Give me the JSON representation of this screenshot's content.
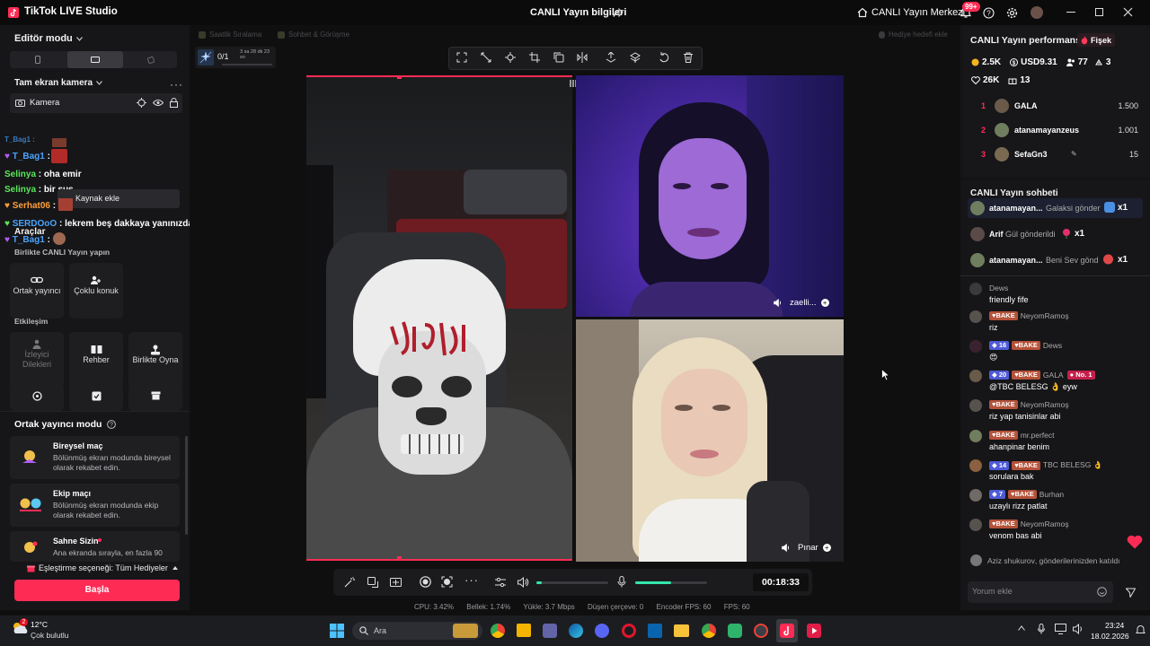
{
  "app": {
    "title": "TikTok LIVE Studio",
    "center_title": "CANLI Yayın bilgileri",
    "live_center": "CANLI Yayın Merkezi",
    "notif_badge": "99+"
  },
  "left": {
    "editor_mode": "Editör modu",
    "camera_mode": "Tam ekran kamera",
    "camera_source": "Kamera",
    "overlay_chat": [
      {
        "user": "T_Bag1",
        "msg": "",
        "user_color": "#4aa3ff"
      },
      {
        "user": "Selinya",
        "msg": "oha emir",
        "user_color": "#5ce65c"
      },
      {
        "user": "Selinya",
        "msg": "bir sus",
        "user_color": "#5ce65c"
      },
      {
        "user": "Serhat06",
        "msg": "",
        "user_color": "#ff9f3a"
      },
      {
        "user": "SERDOoO",
        "msg": "lekrem beş dakkaya yanınızdayız pınar hanım acın kapıyı",
        "user_color": "#4aa3ff"
      },
      {
        "user": "T_Bag1",
        "msg": "",
        "user_color": "#4aa3ff"
      }
    ],
    "tooltip": "Kaynak ekle",
    "tools_label": "Araçlar",
    "together_label": "Birlikte CANLI Yayın yapın",
    "tiles_row1": [
      "Ortak yayıncı",
      "Çoklu konuk"
    ],
    "interaction_label": "Etkileşim",
    "tiles_row2": [
      "İzleyici Dilekleri",
      "Rehber",
      "Birlikte Oyna"
    ],
    "cohost_mode": "Ortak yayıncı modu",
    "modes": [
      {
        "title": "Bireysel maç",
        "desc": "Bölünmüş ekran modunda bireysel olarak rekabet edin."
      },
      {
        "title": "Ekip maçı",
        "desc": "Bölünmüş ekran modunda ekip olarak rekabet edin."
      },
      {
        "title": "Sahne Sizin",
        "desc": "Ana ekranda sırayla, en fazla 90"
      }
    ],
    "match_option": "Eşleştirme seçeneği: Tüm Hediyeler",
    "start_button": "Başla"
  },
  "center": {
    "tabs": [
      "Saatlik Sıralama",
      "Sohbet & Görüşme",
      "Hediye hedefi ekle"
    ],
    "goal_count": "0/1",
    "goal_time": "3 sa 28 dk 23 sn",
    "guests": [
      {
        "name": "zaelli..."
      },
      {
        "name": "Pınar"
      }
    ],
    "timer": "00:18:33",
    "stats": {
      "cpu": "CPU: 3.42%",
      "mem": "Bellek: 1.74%",
      "upload": "Yükle: 3.7 Mbps",
      "dropped": "Düşen çerçeve: 0",
      "encoder_fps": "Encoder FPS: 60",
      "fps": "FPS: 60"
    },
    "volume_level": 0.08,
    "mic_level": 0.5
  },
  "right": {
    "perf_title": "CANLI Yayın performansı",
    "fire_label": "Fişek",
    "metrics": {
      "coins": "2.5K",
      "usd": "USD9.31",
      "viewers": "77",
      "users": "3",
      "likes": "26K",
      "gifts": "13"
    },
    "leaderboard": [
      {
        "rank": "1",
        "name": "GALA",
        "score": "1.500"
      },
      {
        "rank": "2",
        "name": "atanamayanzeus",
        "score": "1.001"
      },
      {
        "rank": "3",
        "name": "SefaGn3",
        "score": "15"
      }
    ],
    "chat_title": "CANLI Yayın sohbeti",
    "gifts": [
      {
        "user": "atanamayan...",
        "text": "Galaksi gönder",
        "count": "x1"
      },
      {
        "user": "Arif",
        "text": "Gül gönderildi",
        "count": "x1"
      },
      {
        "user": "atanamayan...",
        "text": "Beni Sev gönd",
        "count": "x1"
      }
    ],
    "chat": [
      {
        "badges": [],
        "user": "Dews",
        "msg": "friendly fife"
      },
      {
        "badges": [
          "BAKE"
        ],
        "user": "NeyomRamoş",
        "msg": "riz"
      },
      {
        "badges": [
          "16",
          "BAKE"
        ],
        "user": "Dews",
        "msg": "😍"
      },
      {
        "badges": [
          "20",
          "BAKE"
        ],
        "user": "GALA",
        "extra": "No. 1",
        "msg": "@TBC BELESG 👌 eyw"
      },
      {
        "badges": [
          "BAKE"
        ],
        "user": "NeyomRamoş",
        "msg": "riz yap tanisinlar abi"
      },
      {
        "badges": [
          "BAKE"
        ],
        "user": "mr.perfect",
        "msg": "ahanpinar benim"
      },
      {
        "badges": [
          "14",
          "BAKE"
        ],
        "user": "TBC BELESG 👌",
        "msg": "sorulara bak"
      },
      {
        "badges": [
          "7",
          "BAKE"
        ],
        "user": "Burhan",
        "msg": "uzaylı rizz patlat"
      },
      {
        "badges": [
          "BAKE"
        ],
        "user": "NeyomRamoş",
        "msg": "venom bas abi"
      }
    ],
    "join_msg_user": "Aziz shukurov",
    "join_msg": ", gönderilerinizden katıldı",
    "comment_placeholder": "Yorum ekle"
  },
  "taskbar": {
    "weather_temp": "12°C",
    "weather_desc": "Çok bulutlu",
    "weather_badge": "2",
    "search": "Ara",
    "time": "23:24",
    "date": "18.02.2026"
  },
  "colors": {
    "accent": "#fe2c55",
    "bg": "#0f0f10",
    "panel": "#161618"
  }
}
